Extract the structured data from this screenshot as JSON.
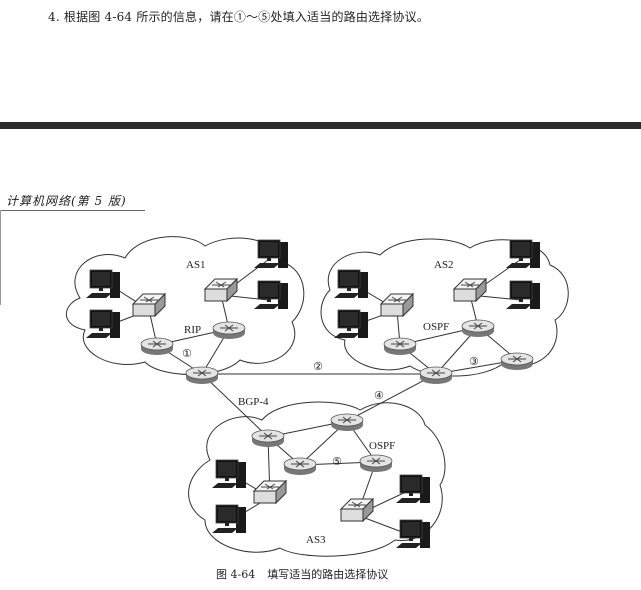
{
  "question": {
    "text": "4. 根据图 4-64 所示的信息，请在①～⑤处填入适当的路由选择协议。"
  },
  "page_header": {
    "title": "计算机网络(第 5 版)"
  },
  "figure": {
    "as_labels": {
      "as1": "AS1",
      "as2": "AS2",
      "as3": "AS3"
    },
    "protocol_labels": {
      "rip": "RIP",
      "ospf_as2": "OSPF",
      "bgp": "BGP-4",
      "ospf_as3": "OSPF"
    },
    "blanks": [
      "①",
      "②",
      "③",
      "④",
      "⑤"
    ],
    "caption_number": "图 4-64",
    "caption_title": "填写适当的路由选择协议"
  }
}
